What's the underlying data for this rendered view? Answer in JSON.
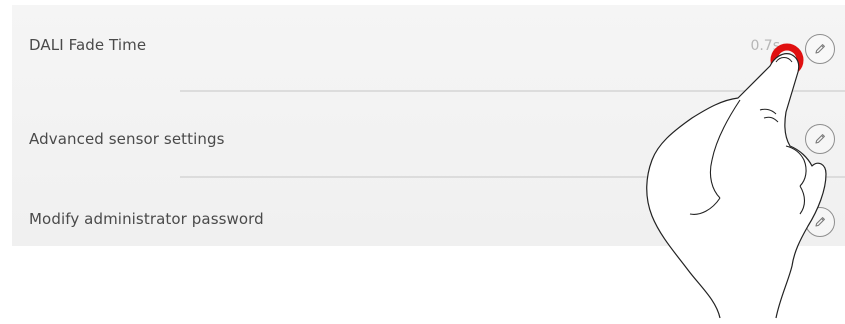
{
  "settings": {
    "rows": [
      {
        "label": "DALI Fade Time",
        "value": "0.7s",
        "action_icon": "pencil-icon"
      },
      {
        "label": "Advanced sensor settings",
        "value": "",
        "action_icon": "pencil-icon"
      },
      {
        "label": "Modify administrator password",
        "value": "",
        "action_icon": "pencil-icon"
      }
    ]
  },
  "overlay": {
    "gesture_icon": "pointing-hand-icon",
    "tap_indicator_color": "#e01010"
  },
  "colors": {
    "panel_background": "#f3f3f3",
    "label_text": "#4a4a4a",
    "value_text": "#b6b6b6",
    "icon_stroke": "#8e8e8e",
    "divider": "#dcdcdc"
  }
}
